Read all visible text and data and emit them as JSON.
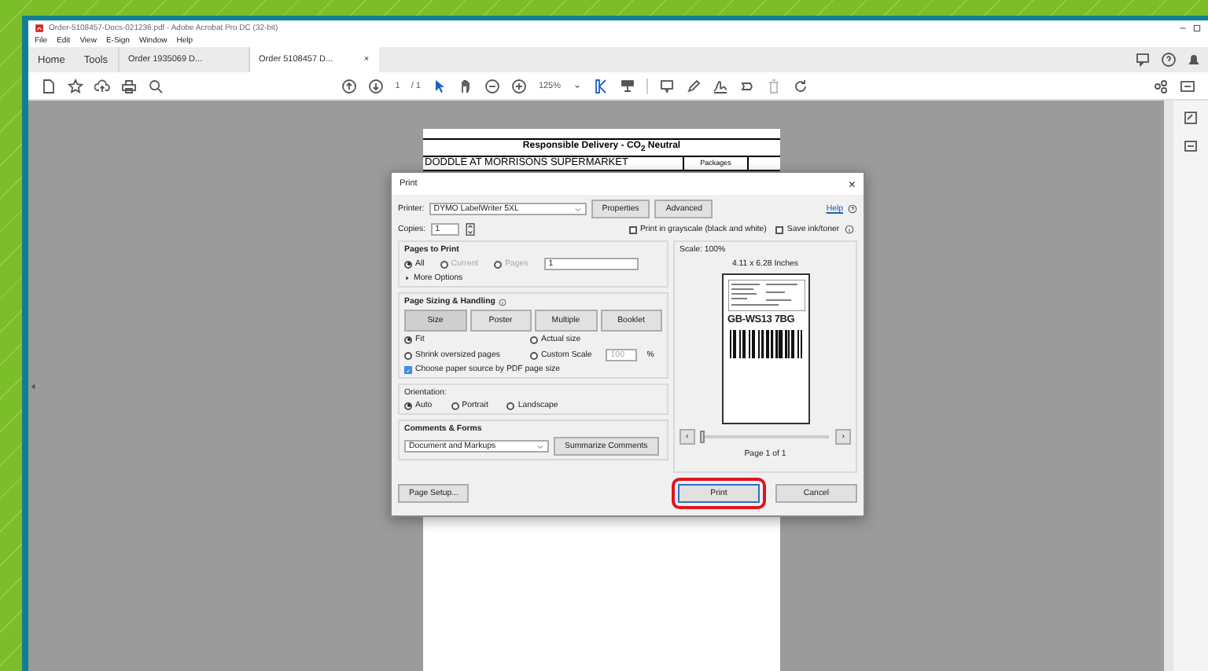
{
  "window": {
    "title": "Order-5108457-Docs-021236.pdf - Adobe Acrobat Pro DC (32-bit)"
  },
  "menu": [
    "File",
    "Edit",
    "View",
    "E-Sign",
    "Window",
    "Help"
  ],
  "tabs": [
    {
      "label": "Home",
      "selected": false
    },
    {
      "label": "Tools",
      "selected": false
    },
    {
      "label": "Order 1935069 D...",
      "selected": false
    },
    {
      "label": "Order 5108457 D...",
      "selected": true,
      "close": "×"
    }
  ],
  "toolbar": {
    "page": "1",
    "page_total": "/ 1",
    "zoom": "125%"
  },
  "document": {
    "heading": "Responsible Delivery - CO$_{2}$ Neutral",
    "address": "DODDLE AT MORRISONS SUPERMARKET",
    "packages_label": "Packages"
  },
  "print_dialog": {
    "title": "Print",
    "close": "×",
    "printer_label": "Printer:",
    "printer": "DYMO LabelWriter 5XL",
    "properties": "Properties",
    "advanced": "Advanced",
    "help": "Help",
    "copies_label": "Copies:",
    "copies": "1",
    "options": [
      {
        "label": "Print in grayscale (black and white)",
        "checked": false
      },
      {
        "label": "Save ink/toner",
        "checked": false
      }
    ],
    "pages": {
      "title": "Pages to Print",
      "choices": [
        {
          "label": "All",
          "selected": true,
          "disabled": false
        },
        {
          "label": "Current",
          "selected": false,
          "disabled": true
        },
        {
          "label": "Pages",
          "selected": false,
          "disabled": true
        }
      ],
      "range": "1",
      "more": "More Options"
    },
    "sizing": {
      "title": "Page Sizing & Handling",
      "modes": [
        {
          "label": "Size",
          "selected": true
        },
        {
          "label": "Poster",
          "selected": false
        },
        {
          "label": "Multiple",
          "selected": false
        },
        {
          "label": "Booklet",
          "selected": false
        }
      ],
      "choices": [
        {
          "label": "Fit",
          "selected": true
        },
        {
          "label": "Actual size",
          "selected": false
        },
        {
          "label": "Shrink oversized pages",
          "selected": false
        },
        {
          "label": "Custom Scale",
          "selected": false
        }
      ],
      "scale": "100",
      "percent": "%",
      "paper_source": {
        "label": "Choose paper source by PDF page size",
        "checked": true
      }
    },
    "orientation": {
      "title": "Orientation:",
      "choices": [
        {
          "label": "Auto",
          "selected": true
        },
        {
          "label": "Portrait",
          "selected": false
        },
        {
          "label": "Landscape",
          "selected": false
        }
      ]
    },
    "comments": {
      "title": "Comments & Forms",
      "value": "Document and Markups",
      "summarize": "Summarize Comments"
    },
    "page_setup": "Page Setup...",
    "preview": {
      "scale": "Scale: 100%",
      "size": "4.11 x 6.28 Inches",
      "label_code": "GB-WS13 7BG",
      "prev": "‹",
      "next": "›",
      "level": 0,
      "page": "Page 1 of 1"
    },
    "print": "Print",
    "cancel": "Cancel"
  }
}
